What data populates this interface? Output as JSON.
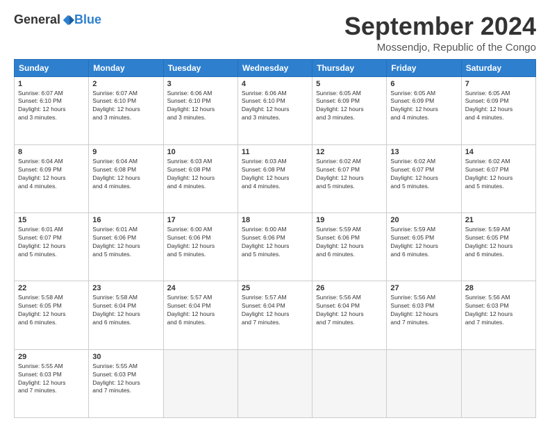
{
  "header": {
    "logo_general": "General",
    "logo_blue": "Blue",
    "month_title": "September 2024",
    "location": "Mossendjo, Republic of the Congo"
  },
  "weekdays": [
    "Sunday",
    "Monday",
    "Tuesday",
    "Wednesday",
    "Thursday",
    "Friday",
    "Saturday"
  ],
  "weeks": [
    [
      {
        "day": "1",
        "info": "Sunrise: 6:07 AM\nSunset: 6:10 PM\nDaylight: 12 hours\nand 3 minutes."
      },
      {
        "day": "2",
        "info": "Sunrise: 6:07 AM\nSunset: 6:10 PM\nDaylight: 12 hours\nand 3 minutes."
      },
      {
        "day": "3",
        "info": "Sunrise: 6:06 AM\nSunset: 6:10 PM\nDaylight: 12 hours\nand 3 minutes."
      },
      {
        "day": "4",
        "info": "Sunrise: 6:06 AM\nSunset: 6:10 PM\nDaylight: 12 hours\nand 3 minutes."
      },
      {
        "day": "5",
        "info": "Sunrise: 6:05 AM\nSunset: 6:09 PM\nDaylight: 12 hours\nand 3 minutes."
      },
      {
        "day": "6",
        "info": "Sunrise: 6:05 AM\nSunset: 6:09 PM\nDaylight: 12 hours\nand 4 minutes."
      },
      {
        "day": "7",
        "info": "Sunrise: 6:05 AM\nSunset: 6:09 PM\nDaylight: 12 hours\nand 4 minutes."
      }
    ],
    [
      {
        "day": "8",
        "info": "Sunrise: 6:04 AM\nSunset: 6:09 PM\nDaylight: 12 hours\nand 4 minutes."
      },
      {
        "day": "9",
        "info": "Sunrise: 6:04 AM\nSunset: 6:08 PM\nDaylight: 12 hours\nand 4 minutes."
      },
      {
        "day": "10",
        "info": "Sunrise: 6:03 AM\nSunset: 6:08 PM\nDaylight: 12 hours\nand 4 minutes."
      },
      {
        "day": "11",
        "info": "Sunrise: 6:03 AM\nSunset: 6:08 PM\nDaylight: 12 hours\nand 4 minutes."
      },
      {
        "day": "12",
        "info": "Sunrise: 6:02 AM\nSunset: 6:07 PM\nDaylight: 12 hours\nand 5 minutes."
      },
      {
        "day": "13",
        "info": "Sunrise: 6:02 AM\nSunset: 6:07 PM\nDaylight: 12 hours\nand 5 minutes."
      },
      {
        "day": "14",
        "info": "Sunrise: 6:02 AM\nSunset: 6:07 PM\nDaylight: 12 hours\nand 5 minutes."
      }
    ],
    [
      {
        "day": "15",
        "info": "Sunrise: 6:01 AM\nSunset: 6:07 PM\nDaylight: 12 hours\nand 5 minutes."
      },
      {
        "day": "16",
        "info": "Sunrise: 6:01 AM\nSunset: 6:06 PM\nDaylight: 12 hours\nand 5 minutes."
      },
      {
        "day": "17",
        "info": "Sunrise: 6:00 AM\nSunset: 6:06 PM\nDaylight: 12 hours\nand 5 minutes."
      },
      {
        "day": "18",
        "info": "Sunrise: 6:00 AM\nSunset: 6:06 PM\nDaylight: 12 hours\nand 5 minutes."
      },
      {
        "day": "19",
        "info": "Sunrise: 5:59 AM\nSunset: 6:06 PM\nDaylight: 12 hours\nand 6 minutes."
      },
      {
        "day": "20",
        "info": "Sunrise: 5:59 AM\nSunset: 6:05 PM\nDaylight: 12 hours\nand 6 minutes."
      },
      {
        "day": "21",
        "info": "Sunrise: 5:59 AM\nSunset: 6:05 PM\nDaylight: 12 hours\nand 6 minutes."
      }
    ],
    [
      {
        "day": "22",
        "info": "Sunrise: 5:58 AM\nSunset: 6:05 PM\nDaylight: 12 hours\nand 6 minutes."
      },
      {
        "day": "23",
        "info": "Sunrise: 5:58 AM\nSunset: 6:04 PM\nDaylight: 12 hours\nand 6 minutes."
      },
      {
        "day": "24",
        "info": "Sunrise: 5:57 AM\nSunset: 6:04 PM\nDaylight: 12 hours\nand 6 minutes."
      },
      {
        "day": "25",
        "info": "Sunrise: 5:57 AM\nSunset: 6:04 PM\nDaylight: 12 hours\nand 7 minutes."
      },
      {
        "day": "26",
        "info": "Sunrise: 5:56 AM\nSunset: 6:04 PM\nDaylight: 12 hours\nand 7 minutes."
      },
      {
        "day": "27",
        "info": "Sunrise: 5:56 AM\nSunset: 6:03 PM\nDaylight: 12 hours\nand 7 minutes."
      },
      {
        "day": "28",
        "info": "Sunrise: 5:56 AM\nSunset: 6:03 PM\nDaylight: 12 hours\nand 7 minutes."
      }
    ],
    [
      {
        "day": "29",
        "info": "Sunrise: 5:55 AM\nSunset: 6:03 PM\nDaylight: 12 hours\nand 7 minutes."
      },
      {
        "day": "30",
        "info": "Sunrise: 5:55 AM\nSunset: 6:03 PM\nDaylight: 12 hours\nand 7 minutes."
      },
      {
        "day": "",
        "info": ""
      },
      {
        "day": "",
        "info": ""
      },
      {
        "day": "",
        "info": ""
      },
      {
        "day": "",
        "info": ""
      },
      {
        "day": "",
        "info": ""
      }
    ]
  ]
}
